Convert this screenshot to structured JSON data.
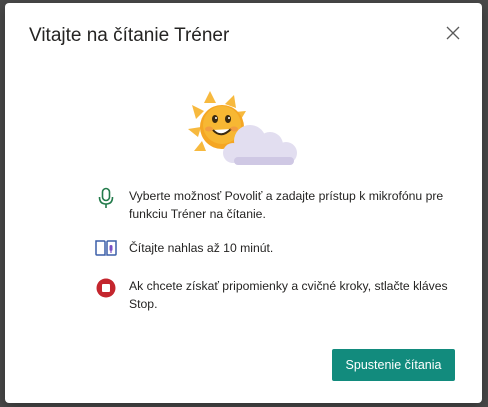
{
  "dialog": {
    "title": "Vitajte na čítanie Tréner",
    "close_icon": "close-icon",
    "illustration": "sun-with-cloud-illustration",
    "items": [
      {
        "icon": "microphone-icon",
        "icon_color": "#237b4b",
        "text": "Vyberte možnosť Povoliť a zadajte prístup k mikrofónu pre funkciu Tréner na čítanie."
      },
      {
        "icon": "reading-book-icon",
        "icon_color": "#3b5fa8",
        "text": "Čítajte nahlas až 10 minút."
      },
      {
        "icon": "stop-icon",
        "icon_color": "#c4262e",
        "text": "Ak chcete získať pripomienky a cvičné kroky, stlačte kláves Stop."
      }
    ],
    "start_button_label": "Spustenie čítania",
    "accent_color": "#128b7d"
  }
}
